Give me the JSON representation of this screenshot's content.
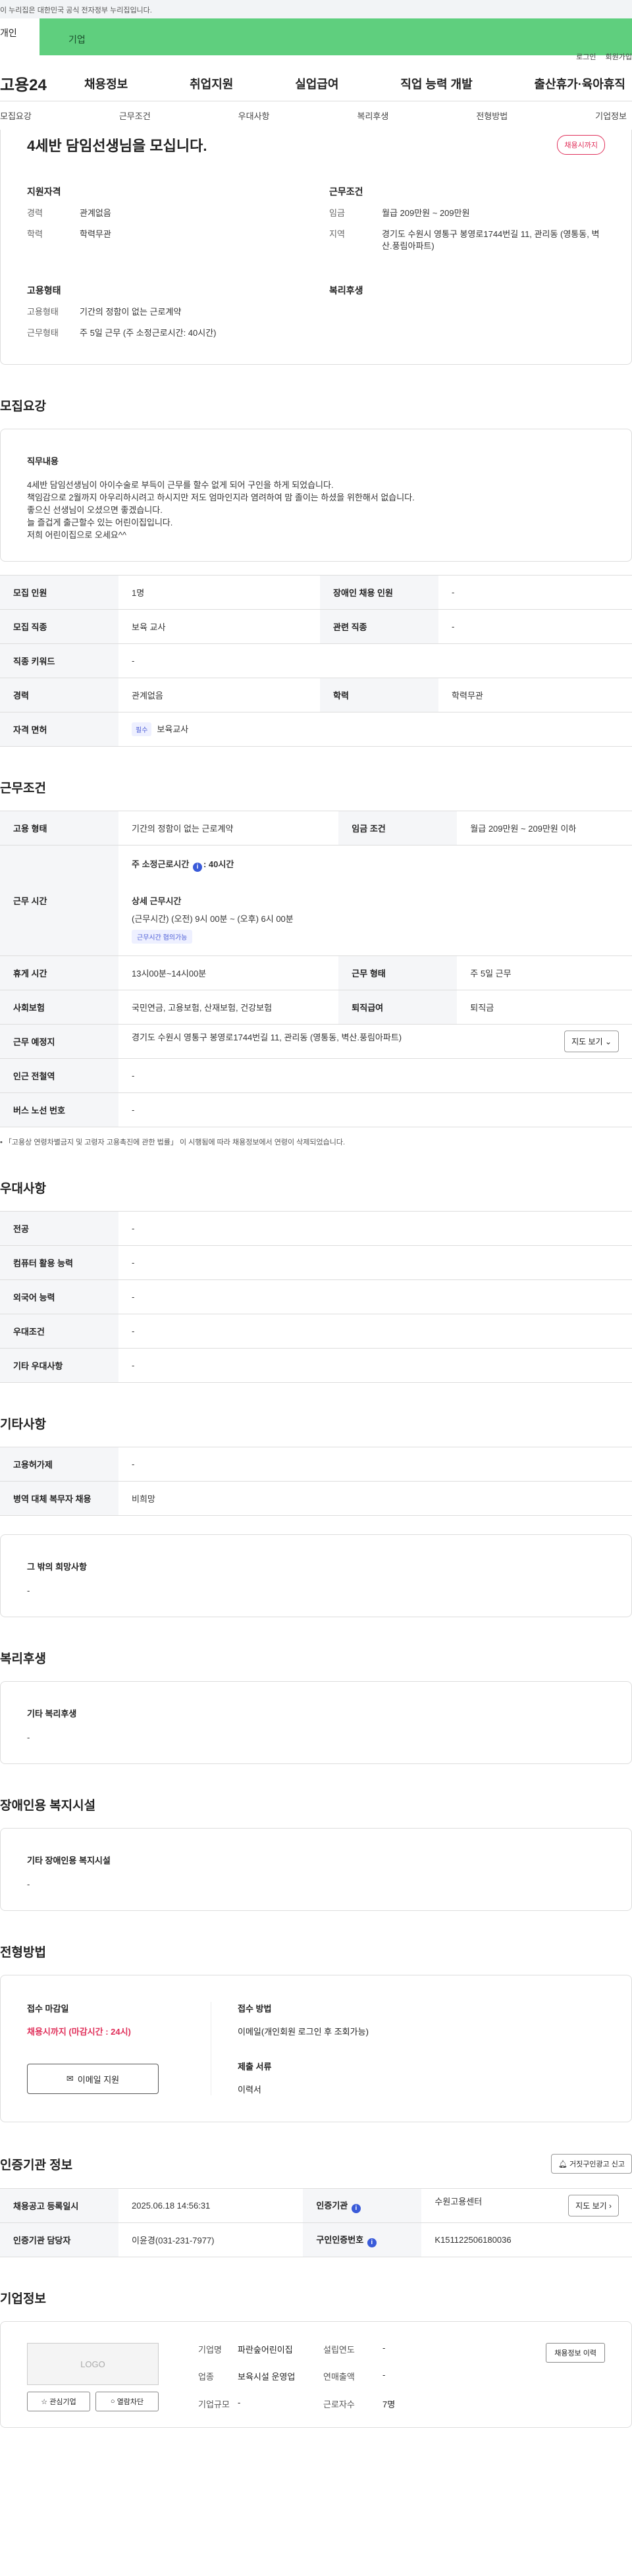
{
  "gov_notice": "이 누리집은 대한민국 공식 전자정부 누리집입니다.",
  "tabs": {
    "personal": "개인",
    "company": "기업"
  },
  "util": {
    "login": "로그인",
    "join": "회원가입"
  },
  "logo": "고용24",
  "gnb": [
    "채용정보",
    "취업지원",
    "실업급여",
    "직업 능력 개발",
    "출산휴가·육아휴직"
  ],
  "snb": [
    "모집요강",
    "근무조건",
    "우대사항",
    "복리후생",
    "전형방법",
    "기업정보"
  ],
  "job": {
    "title": "4세반 담임선생님을 모십니다.",
    "badge": "채용시까지",
    "qual_title": "지원자격",
    "career_k": "경력",
    "career_v": "관계없음",
    "edu_k": "학력",
    "edu_v": "학력무관",
    "cond_title": "근무조건",
    "wage_k": "임금",
    "wage_v": "월급 209만원 ~ 209만원",
    "region_k": "지역",
    "region_v": "경기도 수원시 영통구 봉영로1744번길 11, 관리동 (영통동, 벽산.풍림아파트)",
    "emp_title": "고용형태",
    "emptype_k": "고용형태",
    "emptype_v": "기간의 정함이 없는 근로계약",
    "worktype_k": "근무형태",
    "worktype_v": "주 5일 근무 (주 소정근로시간: 40시간)",
    "welfare_title": "복리후생"
  },
  "recruit": {
    "section": "모집요강",
    "duty_title": "직무내용",
    "duty_text": "4세반 담임선생님이 아이수술로 부득이 근무를 할수 없게 되어 구인을 하게 되었습니다.\n책임감으로 2월까지 아우리하시려고 하시지만 저도 엄마인지라 염려하여 맘 졸이는 하셨을 위한해서 없습니다.\n좋으신 선생님이 오셨으면 좋겠습니다.\n늘 즐겁게 출근할수 있는 어린이집입니다.\n저희 어린이집으로 오세요^^",
    "rows": [
      {
        "k1": "모집 인원",
        "v1": "1명",
        "k2": "장애인 채용 인원",
        "v2": "-"
      },
      {
        "k1": "모집 직종",
        "v1": "보육 교사",
        "k2": "관련 직종",
        "v2": "-"
      },
      {
        "k1": "직종 키워드",
        "v1": "-"
      },
      {
        "k1": "경력",
        "v1": "관계없음",
        "k2": "학력",
        "v2": "학력무관"
      },
      {
        "k1": "자격 면허",
        "tag": "필수",
        "v1": "보육교사"
      }
    ]
  },
  "work": {
    "section": "근무조건",
    "emptype_k": "고용 형태",
    "emptype_v": "기간의 정함이 없는 근로계약",
    "wage_k": "임금 조건",
    "wage_v": "월급 209만원 ~ 209만원 이하",
    "hours_k": "근무 시간",
    "weekly_label": "주 소정근로시간",
    "weekly_value": ": 40시간",
    "detail_label": "상세 근무시간",
    "detail_value": "(근무시간) (오전) 9시 00분 ~ (오후) 6시 00분",
    "detail_chip": "근무시간 협의가능",
    "rest_k": "휴게 시간",
    "rest_v": "13시00분~14시00분",
    "form_k": "근무 형태",
    "form_v": "주 5일 근무",
    "ins_k": "사회보험",
    "ins_v": "국민연금, 고용보험, 산재보험, 건강보험",
    "ret_k": "퇴직급여",
    "ret_v": "퇴직금",
    "place_k": "근무 예정지",
    "place_v": "경기도 수원시 영통구 봉영로1744번길 11, 관리동 (영통동, 벽산.풍림아파트)",
    "map_btn": "지도 보기",
    "station_k": "인근 전철역",
    "station_v": "-",
    "bus_k": "버스 노선 번호",
    "bus_v": "-",
    "note": "「고용상 연령차별금지 및 고령자 고용촉진에 관한 법률」 이 시행됨에 따라 채용정보에서 연령이 삭제되었습니다."
  },
  "pref": {
    "section": "우대사항",
    "rows": [
      {
        "k": "전공",
        "v": "-"
      },
      {
        "k": "컴퓨터 활용 능력",
        "v": "-"
      },
      {
        "k": "외국어 능력",
        "v": "-"
      },
      {
        "k": "우대조건",
        "v": "-"
      },
      {
        "k": "기타 우대사항",
        "v": "-"
      }
    ]
  },
  "etc": {
    "section": "기타사항",
    "rows": [
      {
        "k": "고용허가제",
        "v": "-"
      },
      {
        "k": "병역 대체 복무자 채용",
        "v": "비희망"
      }
    ],
    "other_title": "그 밖의 희망사항",
    "other_v": "-"
  },
  "welfare": {
    "section": "복리후생",
    "title": "기타 복리후생",
    "v": "-"
  },
  "disab": {
    "section": "장애인용 복지시설",
    "title": "기타 장애인용 복지시설",
    "v": "-"
  },
  "apply": {
    "section": "전형방법",
    "deadline_title": "접수 마감일",
    "deadline_v": "채용시까지 (마감시간 : 24시)",
    "method_title": "접수 방법",
    "method_v": "이메일(개인회원 로그인 후 조회가능)",
    "docs_title": "제출 서류",
    "docs_v": "이력서",
    "email_btn": "이메일 지원"
  },
  "cert": {
    "section": "인증기관 정보",
    "report_btn": "거짓구인광고 신고",
    "reg_k": "채용공고 등록일시",
    "reg_v": "2025.06.18 14:56:31",
    "org_k": "인증기관",
    "org_v": "수원고용센터",
    "map_btn": "지도 보기",
    "mgr_k": "인증기관 담당자",
    "mgr_v": "이윤경(031-231-7977)",
    "no_k": "구인인증번호",
    "no_v": "K151122506180036"
  },
  "company": {
    "section": "기업정보",
    "logo": "LOGO",
    "fav_btn": "관심기업",
    "block_btn": "열람차단",
    "name_k": "기업명",
    "name_v": "파란숲어린이집",
    "year_k": "설립연도",
    "year_v": "-",
    "biz_k": "업종",
    "biz_v": "보육시설 운영업",
    "sales_k": "연매출액",
    "sales_v": "-",
    "size_k": "기업규모",
    "size_v": "-",
    "emp_k": "근로자수",
    "emp_v": "7명",
    "hist_btn": "채용정보 이력"
  }
}
